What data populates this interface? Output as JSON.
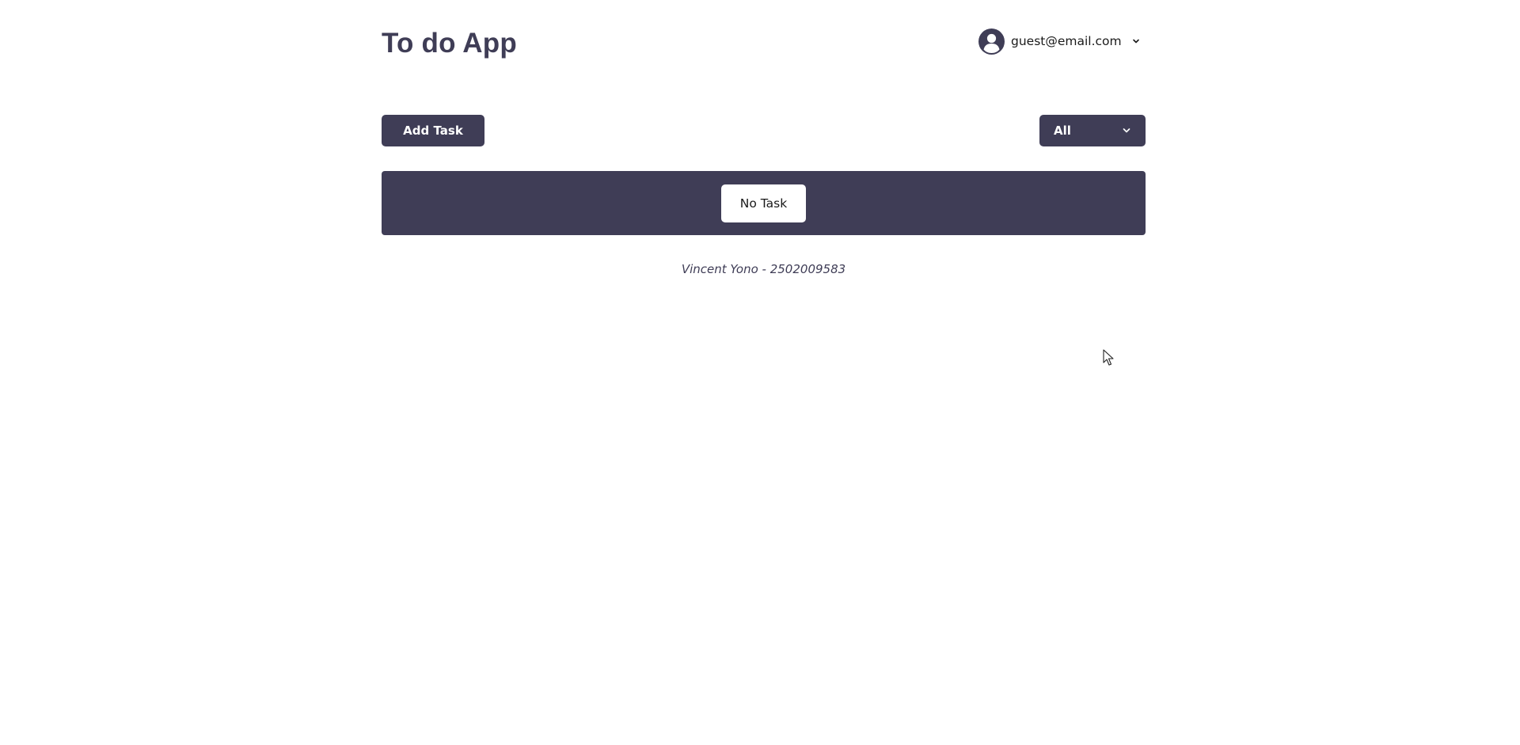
{
  "header": {
    "app_title": "To do App",
    "user_email": "guest@email.com"
  },
  "toolbar": {
    "add_task_label": "Add Task",
    "filter_selected": "All"
  },
  "task_list": {
    "empty_label": "No Task"
  },
  "footer": {
    "credit": "Vincent Yono - 2502009583"
  },
  "colors": {
    "primary": "#3f3d56",
    "background": "#ffffff"
  },
  "icons": {
    "avatar": "user-circle-icon",
    "user_menu_toggle": "chevron-down-icon",
    "filter_toggle": "chevron-down-icon",
    "pointer": "mouse-cursor-icon"
  }
}
